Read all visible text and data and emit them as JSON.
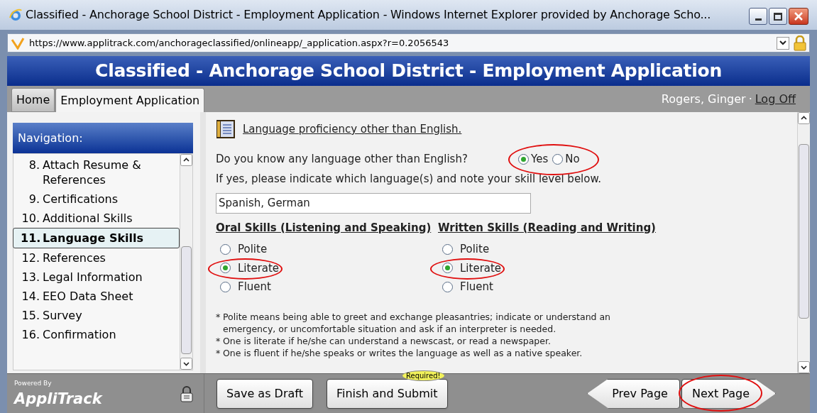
{
  "window": {
    "title": "Classified - Anchorage School District - Employment Application - Windows Internet Explorer provided by Anchorage Scho..."
  },
  "address_bar": {
    "url": "https://www.applitrack.com/anchorageclassified/onlineapp/_application.aspx?r=0.2056543"
  },
  "banner": {
    "title": "Classified - Anchorage School District - Employment Application"
  },
  "tabs": [
    {
      "label": "Home",
      "selected": false
    },
    {
      "label": "Employment Application",
      "selected": true
    }
  ],
  "user": {
    "name": "Rogers, Ginger",
    "separator": "·",
    "logoff": "Log Off"
  },
  "navigation": {
    "title": "Navigation:",
    "items": [
      {
        "number": "8.",
        "label": "Attach Resume & References",
        "selected": false
      },
      {
        "number": "9.",
        "label": "Certifications",
        "selected": false
      },
      {
        "number": "10.",
        "label": "Additional Skills",
        "selected": false
      },
      {
        "number": "11.",
        "label": "Language Skills",
        "selected": true
      },
      {
        "number": "12.",
        "label": "References",
        "selected": false
      },
      {
        "number": "13.",
        "label": "Legal Information",
        "selected": false
      },
      {
        "number": "14.",
        "label": "EEO Data Sheet",
        "selected": false
      },
      {
        "number": "15.",
        "label": "Survey",
        "selected": false
      },
      {
        "number": "16.",
        "label": "Confirmation",
        "selected": false
      }
    ]
  },
  "section": {
    "title": "Language proficiency other than English.",
    "question": "Do you know any language other than English?",
    "answer_circled": true,
    "answers": [
      {
        "label": "Yes",
        "selected": true
      },
      {
        "label": "No",
        "selected": false
      }
    ],
    "instruction": "If yes, please indicate which language(s) and note your skill level below.",
    "languages": {
      "value": "Spanish, German"
    },
    "skill_groups": [
      {
        "heading": "Oral Skills (Listening and Speaking)",
        "options": [
          {
            "label": "Polite",
            "selected": false,
            "circled": false
          },
          {
            "label": "Literate",
            "selected": true,
            "circled": true
          },
          {
            "label": "Fluent",
            "selected": false,
            "circled": false
          }
        ]
      },
      {
        "heading": "Written Skills (Reading and Writing)",
        "options": [
          {
            "label": "Polite",
            "selected": false,
            "circled": false
          },
          {
            "label": "Literate",
            "selected": true,
            "circled": true
          },
          {
            "label": "Fluent",
            "selected": false,
            "circled": false
          }
        ]
      }
    ],
    "notes": [
      {
        "mark": "*",
        "text": "Polite means being able to greet and exchange pleasantries; indicate or understand an emergency, or uncomfortable situation and ask if an interpreter is needed."
      },
      {
        "mark": "*",
        "text": "One is literate if he/she can understand a newscast, or read a newspaper."
      },
      {
        "mark": "*",
        "text": "One is fluent if he/she speaks or writes the language as well as a native speaker."
      }
    ]
  },
  "footer": {
    "powered_by": "Powered By",
    "logo": "AppliTrack",
    "buttons": [
      {
        "kind": "plain",
        "label": "Save as Draft",
        "circled": false
      },
      {
        "kind": "plain",
        "label": "Finish and Submit",
        "badge": "Required!",
        "circled": false
      },
      {
        "kind": "prev",
        "label": "Prev Page",
        "circled": false
      },
      {
        "kind": "next",
        "label": "Next Page",
        "circled": true
      }
    ]
  }
}
